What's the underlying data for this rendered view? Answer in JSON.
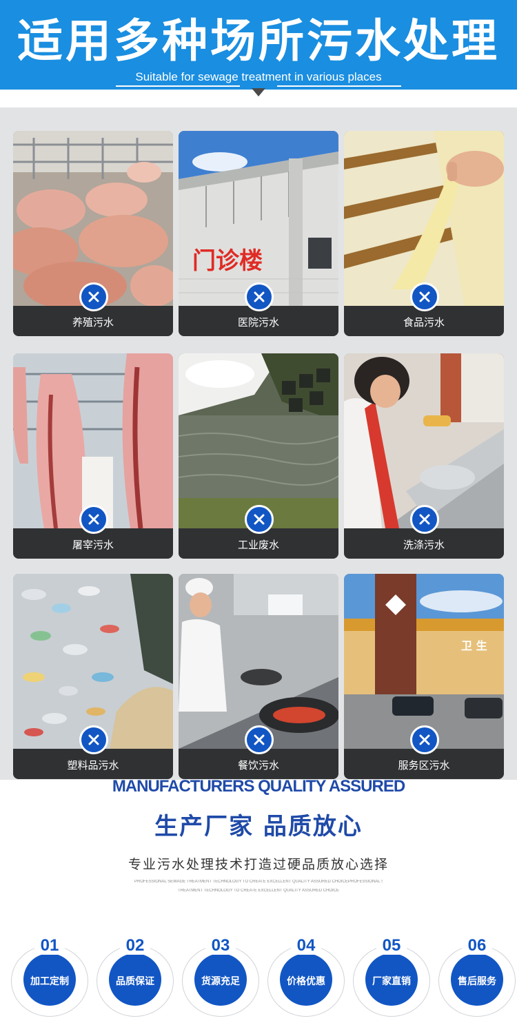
{
  "header": {
    "title": "适用多种场所污水处理",
    "subtitle": "Suitable for sewage treatment in various places"
  },
  "grid": {
    "items": [
      {
        "label": "养殖污水"
      },
      {
        "label": "医院污水",
        "sign_text": "门诊楼"
      },
      {
        "label": "食品污水"
      },
      {
        "label": "屠宰污水"
      },
      {
        "label": "工业废水"
      },
      {
        "label": "洗涤污水"
      },
      {
        "label": "塑料品污水"
      },
      {
        "label": "餐饮污水"
      },
      {
        "label": "服务区污水",
        "sign_text": "卫 生"
      }
    ]
  },
  "quality": {
    "title_en": "MANUFACTURERS QUALITY ASSURED",
    "title_cn": "生产厂家 品质放心",
    "description": "专业污水处理技术打造过硬品质放心选择",
    "small_line1": "PROFESSIONAL SEWAGE TREATMENT TECHNOLOGY TO CREATE EXCELLENT QUALITY ASSURED CHOICEPROFESSIONAL SEWAGE",
    "small_line2": "TREATMENT TECHNOLOGY TO CREATE EXCELLENT QUALITY ASSURED CHOICE"
  },
  "features": [
    {
      "number": "01",
      "label": "加工定制"
    },
    {
      "number": "02",
      "label": "品质保证"
    },
    {
      "number": "03",
      "label": "货源充足"
    },
    {
      "number": "04",
      "label": "价格优惠"
    },
    {
      "number": "05",
      "label": "厂家直销"
    },
    {
      "number": "06",
      "label": "售后服务"
    }
  ],
  "colors": {
    "header_blue": "#1a8ee0",
    "accent_blue": "#1256c4",
    "title_blue": "#1f4aa8",
    "caption_bg": "#2f3133"
  },
  "icons": {
    "badge": "close-icon"
  }
}
